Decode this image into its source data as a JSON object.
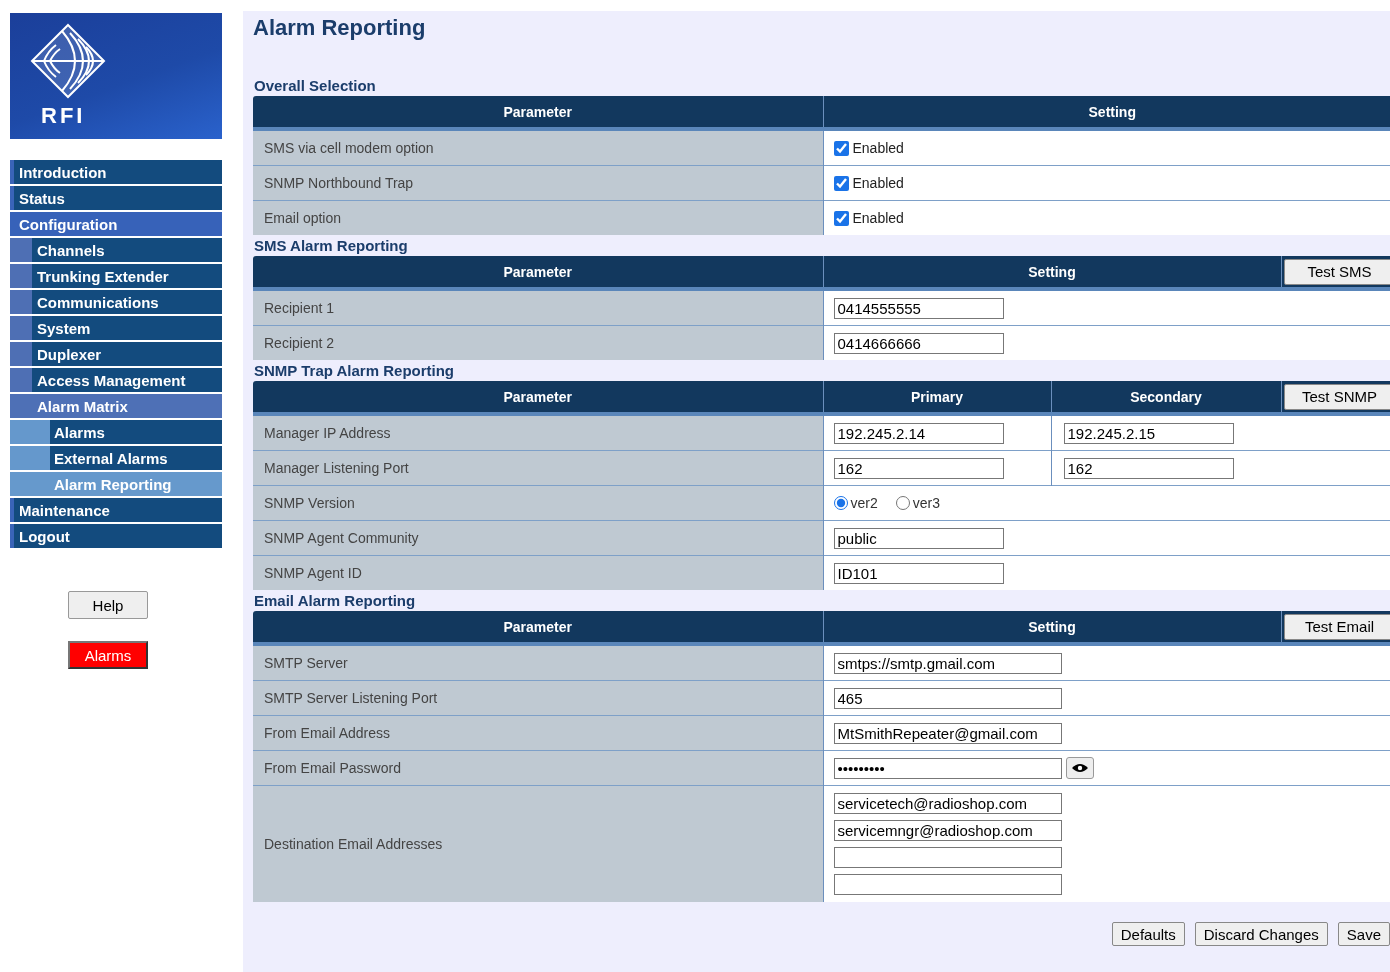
{
  "logo": {
    "text": "RFI"
  },
  "nav": [
    {
      "label": "Introduction",
      "selected": false
    },
    {
      "label": "Status",
      "selected": false
    },
    {
      "label": "Configuration",
      "selected": false,
      "expanded": true,
      "children": [
        {
          "label": "Channels",
          "selected": false
        },
        {
          "label": "Trunking Extender",
          "selected": false
        },
        {
          "label": "Communications",
          "selected": false
        },
        {
          "label": "System",
          "selected": false
        },
        {
          "label": "Duplexer",
          "selected": false
        },
        {
          "label": "Access Management",
          "selected": false
        },
        {
          "label": "Alarm Matrix",
          "selected": false,
          "expanded": true,
          "children": [
            {
              "label": "Alarms",
              "selected": false
            },
            {
              "label": "External Alarms",
              "selected": false
            },
            {
              "label": "Alarm Reporting",
              "selected": true
            }
          ]
        }
      ]
    },
    {
      "label": "Maintenance",
      "selected": false
    },
    {
      "label": "Logout",
      "selected": false
    }
  ],
  "side_buttons": [
    {
      "label": "Help",
      "kind": "normal"
    },
    {
      "label": "Alarms",
      "kind": "alarm"
    }
  ],
  "page_title": "Alarm Reporting",
  "sections": [
    {
      "title": "Overall Selection",
      "columns": [
        "Parameter",
        "Setting"
      ],
      "rows": [
        {
          "label": "SMS via cell modem option",
          "kind": "checkbox",
          "checked": true,
          "text": "Enabled"
        },
        {
          "label": "SNMP Northbound Trap",
          "kind": "checkbox",
          "checked": true,
          "text": "Enabled"
        },
        {
          "label": "Email option",
          "kind": "checkbox",
          "checked": true,
          "text": "Enabled"
        }
      ]
    },
    {
      "title": "SMS Alarm Reporting",
      "columns": [
        "Parameter",
        "Setting"
      ],
      "test_button": "Test SMS",
      "rows": [
        {
          "label": "Recipient 1",
          "kind": "text",
          "values": [
            "0414555555"
          ]
        },
        {
          "label": "Recipient 2",
          "kind": "text",
          "values": [
            "0414666666"
          ]
        }
      ]
    },
    {
      "title": "SNMP Trap Alarm Reporting",
      "columns": [
        "Parameter",
        "Primary",
        "Secondary"
      ],
      "test_button": "Test SNMP",
      "rows": [
        {
          "label": "Manager IP Address",
          "kind": "text",
          "values": [
            "192.245.2.14",
            "192.245.2.15"
          ]
        },
        {
          "label": "Manager Listening Port",
          "kind": "text",
          "values": [
            "162",
            "162"
          ]
        },
        {
          "label": "SNMP Version",
          "kind": "radio",
          "options": [
            {
              "label": "ver2",
              "selected": true
            },
            {
              "label": "ver3",
              "selected": false
            }
          ]
        },
        {
          "label": "SNMP Agent Community",
          "kind": "text",
          "values": [
            "public"
          ]
        },
        {
          "label": "SNMP Agent ID",
          "kind": "text",
          "values": [
            "ID101"
          ]
        }
      ]
    },
    {
      "title": "Email Alarm Reporting",
      "columns": [
        "Parameter",
        "Setting"
      ],
      "test_button": "Test Email",
      "rows": [
        {
          "label": "SMTP Server",
          "kind": "wide",
          "values": [
            "smtps://smtp.gmail.com"
          ]
        },
        {
          "label": "SMTP Server Listening Port",
          "kind": "wide",
          "values": [
            "465"
          ]
        },
        {
          "label": "From Email Address",
          "kind": "wide",
          "values": [
            "MtSmithRepeater@gmail.com"
          ]
        },
        {
          "label": "From Email Password",
          "kind": "password",
          "values": [
            "•••••••••"
          ]
        },
        {
          "label": "Destination Email Addresses",
          "kind": "list",
          "fields": [
            {
              "kind": "filled",
              "value": "servicetech@radioshop.com"
            },
            {
              "kind": "filled",
              "value": "servicemngr@radioshop.com"
            },
            {
              "kind": "blank"
            },
            {
              "kind": "blank"
            }
          ]
        }
      ]
    }
  ],
  "footer_buttons": [
    "Defaults",
    "Discard Changes",
    "Save"
  ]
}
